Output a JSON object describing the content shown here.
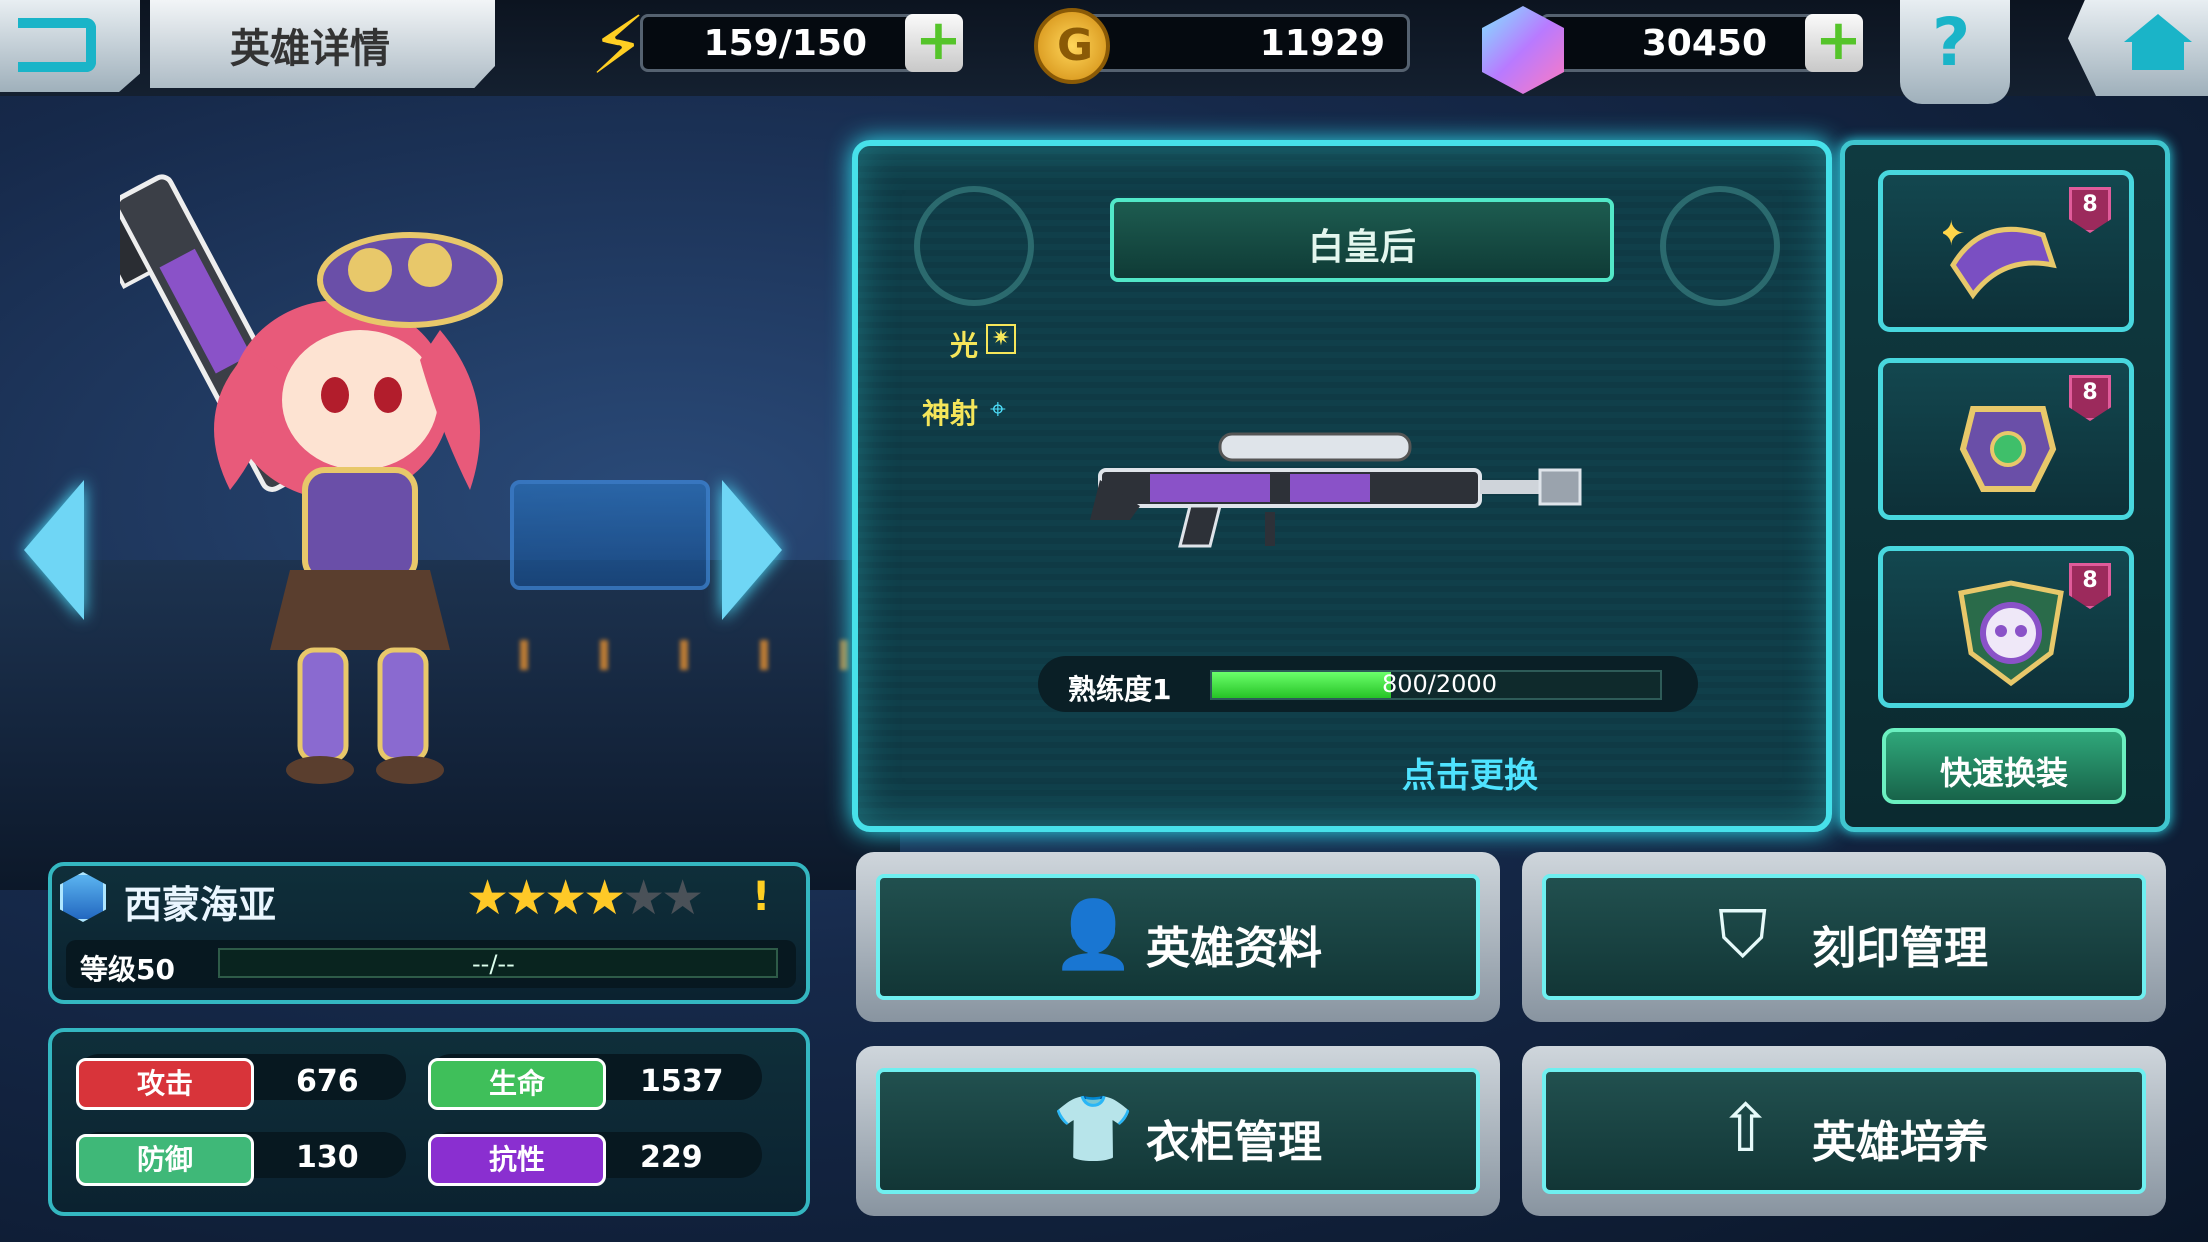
{
  "header": {
    "title": "英雄详情",
    "energy": "159/150",
    "gold": "11929",
    "gold_symbol": "G",
    "gems": "30450",
    "help_symbol": "?"
  },
  "weapon": {
    "name": "白皇后",
    "attribute_element": "光",
    "attribute_skill": "神射",
    "mastery_label": "熟练度1",
    "mastery_current": 800,
    "mastery_max": 2000,
    "mastery_text": "800/2000",
    "change_hint": "点击更换"
  },
  "gear": {
    "slots": [
      {
        "name": "gear-slot-1",
        "level": "8"
      },
      {
        "name": "gear-slot-2",
        "level": "8"
      },
      {
        "name": "gear-slot-3",
        "level": "8"
      }
    ],
    "quick_equip_label": "快速换装"
  },
  "hero": {
    "name": "西蒙海亚",
    "stars_filled": 4,
    "stars_total": 6,
    "alert": "!",
    "level_label": "等级50",
    "exp_text": "--/--"
  },
  "stats": {
    "attack_label": "攻击",
    "attack_value": "676",
    "hp_label": "生命",
    "hp_value": "1537",
    "defense_label": "防御",
    "defense_value": "130",
    "resist_label": "抗性",
    "resist_value": "229"
  },
  "menu": {
    "hero_info": "英雄资料",
    "imprint": "刻印管理",
    "wardrobe": "衣柜管理",
    "training": "英雄培养"
  },
  "colors": {
    "accent": "#47e1ea",
    "attack": "#d8343a",
    "hp": "#3fbf5a",
    "defense": "#3fb878",
    "resist": "#8a2fd0",
    "mastery_fill": "#3ad83a"
  }
}
